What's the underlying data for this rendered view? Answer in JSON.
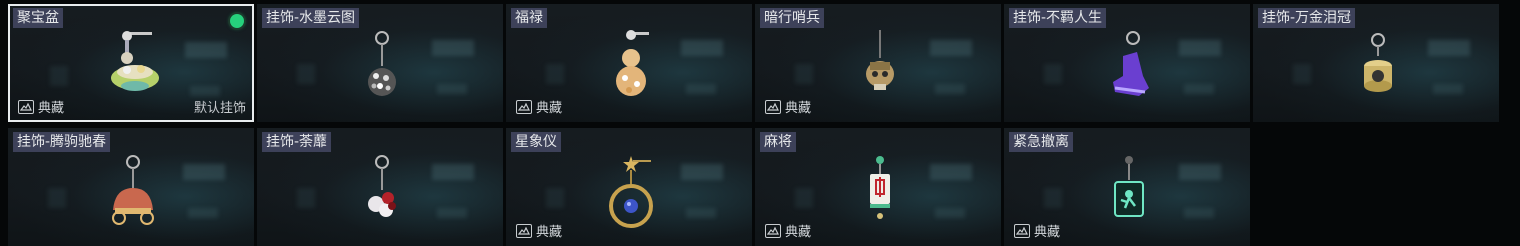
{
  "items": [
    {
      "name": "聚宝盆",
      "collection": "典藏",
      "default_tag": "默认挂饰",
      "selected": true,
      "equipped": true,
      "icon": "treasure-bowl-charm-icon"
    },
    {
      "name": "挂饰-水墨云图",
      "collection": "",
      "icon": "disco-ball-charm-icon"
    },
    {
      "name": "福禄",
      "collection": "典藏",
      "icon": "gourd-charm-icon"
    },
    {
      "name": "暗行哨兵",
      "collection": "典藏",
      "icon": "sentinel-skull-charm-icon"
    },
    {
      "name": "挂饰-不羁人生",
      "collection": "",
      "icon": "purple-sneaker-charm-icon"
    },
    {
      "name": "挂饰-万金泪冠",
      "collection": "",
      "icon": "gold-coin-stack-charm-icon"
    },
    {
      "name": "挂饰-腾驹驰春",
      "collection": "",
      "icon": "carriage-charm-icon"
    },
    {
      "name": "挂饰-荼蘼",
      "collection": "",
      "icon": "flower-charm-icon"
    },
    {
      "name": "星象仪",
      "collection": "典藏",
      "icon": "astrolabe-charm-icon"
    },
    {
      "name": "麻将",
      "collection": "典藏",
      "icon": "mahjong-tile-charm-icon"
    },
    {
      "name": "紧急撤离",
      "collection": "典藏",
      "icon": "emergency-exit-charm-icon"
    }
  ],
  "colors": {
    "label_bg": "#444864",
    "selected_border": "#e8ecee",
    "equipped_dot": "#26d07c"
  }
}
